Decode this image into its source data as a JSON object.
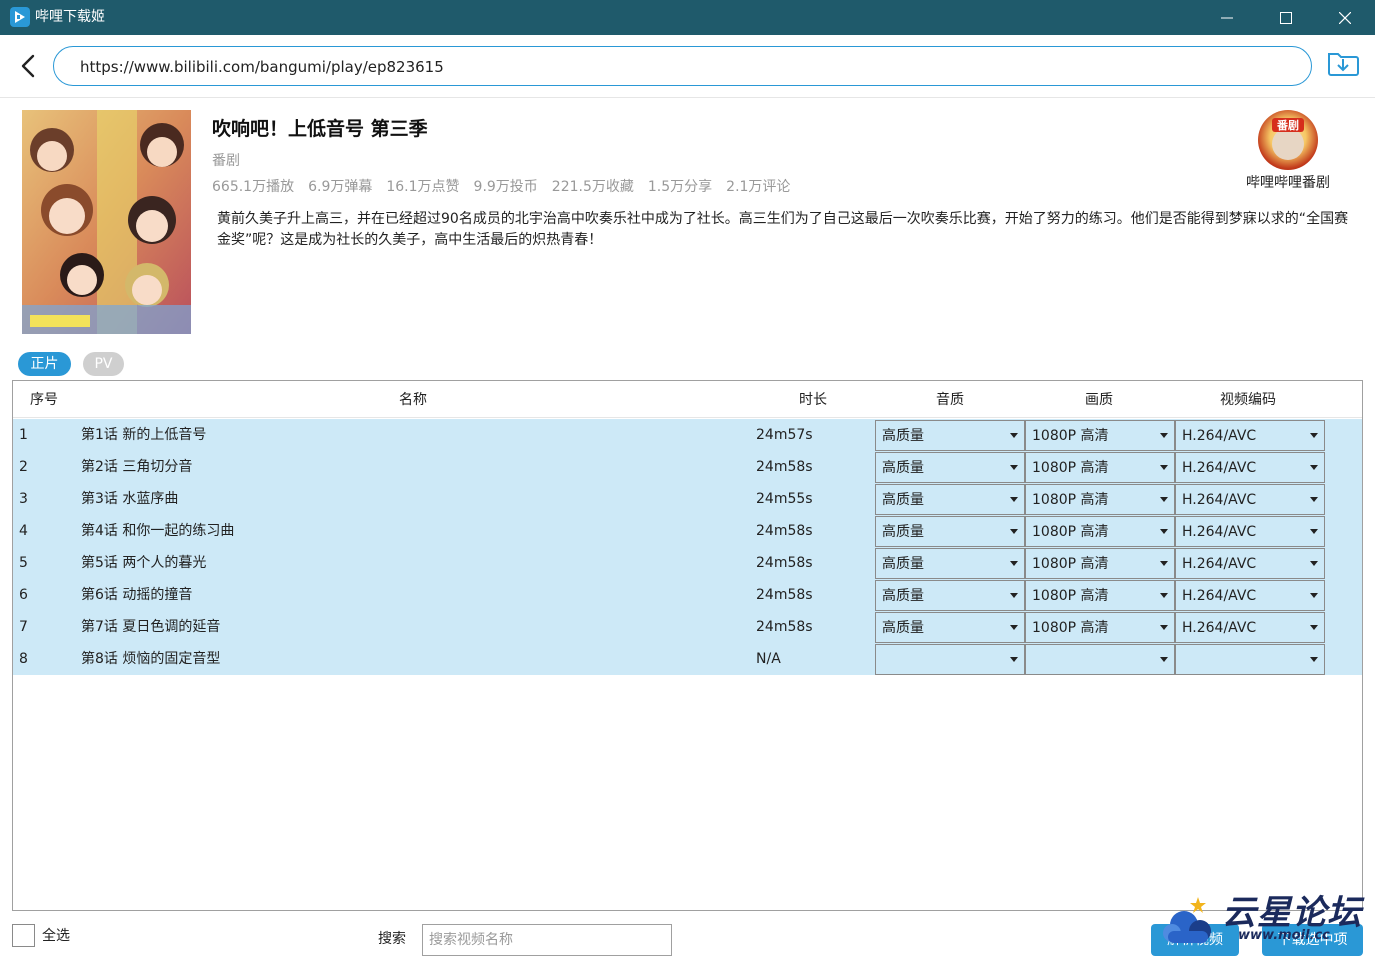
{
  "window": {
    "title": "哔哩下载姬"
  },
  "address": {
    "url": "https://www.bilibili.com/bangumi/play/ep823615"
  },
  "show": {
    "title": "吹响吧！上低音号 第三季",
    "type": "番剧",
    "stats": [
      "665.1万播放",
      "6.9万弹幕",
      "16.1万点赞",
      "9.9万投币",
      "221.5万收藏",
      "1.5万分享",
      "2.1万评论"
    ],
    "description": "黄前久美子升上高三，并在已经超过90名成员的北宇治高中吹奏乐社中成为了社长。高三生们为了自己这最后一次吹奏乐比赛，开始了努力的练习。他们是否能得到梦寐以求的“全国赛金奖”呢？这是成为社长的久美子，高中生活最后的炽热青春！",
    "uploader": "哔哩哔哩番剧",
    "avatar_text": "番剧"
  },
  "tabs": [
    {
      "label": "正片",
      "active": true
    },
    {
      "label": "PV",
      "active": false
    }
  ],
  "table": {
    "headers": {
      "index": "序号",
      "name": "名称",
      "duration": "时长",
      "audio": "音质",
      "video": "画质",
      "codec": "视频编码"
    },
    "rows": [
      {
        "index": "1",
        "name": "第1话 新的上低音号",
        "duration": "24m57s",
        "audio": "高质量",
        "video": "1080P 高清",
        "codec": "H.264/AVC"
      },
      {
        "index": "2",
        "name": "第2话 三角切分音",
        "duration": "24m58s",
        "audio": "高质量",
        "video": "1080P 高清",
        "codec": "H.264/AVC"
      },
      {
        "index": "3",
        "name": "第3话 水蓝序曲",
        "duration": "24m55s",
        "audio": "高质量",
        "video": "1080P 高清",
        "codec": "H.264/AVC"
      },
      {
        "index": "4",
        "name": "第4话 和你一起的练习曲",
        "duration": "24m58s",
        "audio": "高质量",
        "video": "1080P 高清",
        "codec": "H.264/AVC"
      },
      {
        "index": "5",
        "name": "第5话 两个人的暮光",
        "duration": "24m58s",
        "audio": "高质量",
        "video": "1080P 高清",
        "codec": "H.264/AVC"
      },
      {
        "index": "6",
        "name": "第6话 动摇的撞音",
        "duration": "24m58s",
        "audio": "高质量",
        "video": "1080P 高清",
        "codec": "H.264/AVC"
      },
      {
        "index": "7",
        "name": "第7话 夏日色调的延音",
        "duration": "24m58s",
        "audio": "高质量",
        "video": "1080P 高清",
        "codec": "H.264/AVC"
      },
      {
        "index": "8",
        "name": "第8话 烦恼的固定音型",
        "duration": "N/A",
        "audio": "",
        "video": "",
        "codec": ""
      }
    ]
  },
  "footer": {
    "select_all": "全选",
    "search_label": "搜索",
    "search_placeholder": "搜索视频名称",
    "parse_button": "解析视频",
    "download_button": "下载选中项"
  },
  "watermark": {
    "text": "云星论坛",
    "url": "www.moil.cc"
  },
  "colors": {
    "titlebar": "#1f5a6b",
    "accent": "#2a98d6",
    "row_highlight": "#cde9f7",
    "muted_text": "#999999"
  }
}
